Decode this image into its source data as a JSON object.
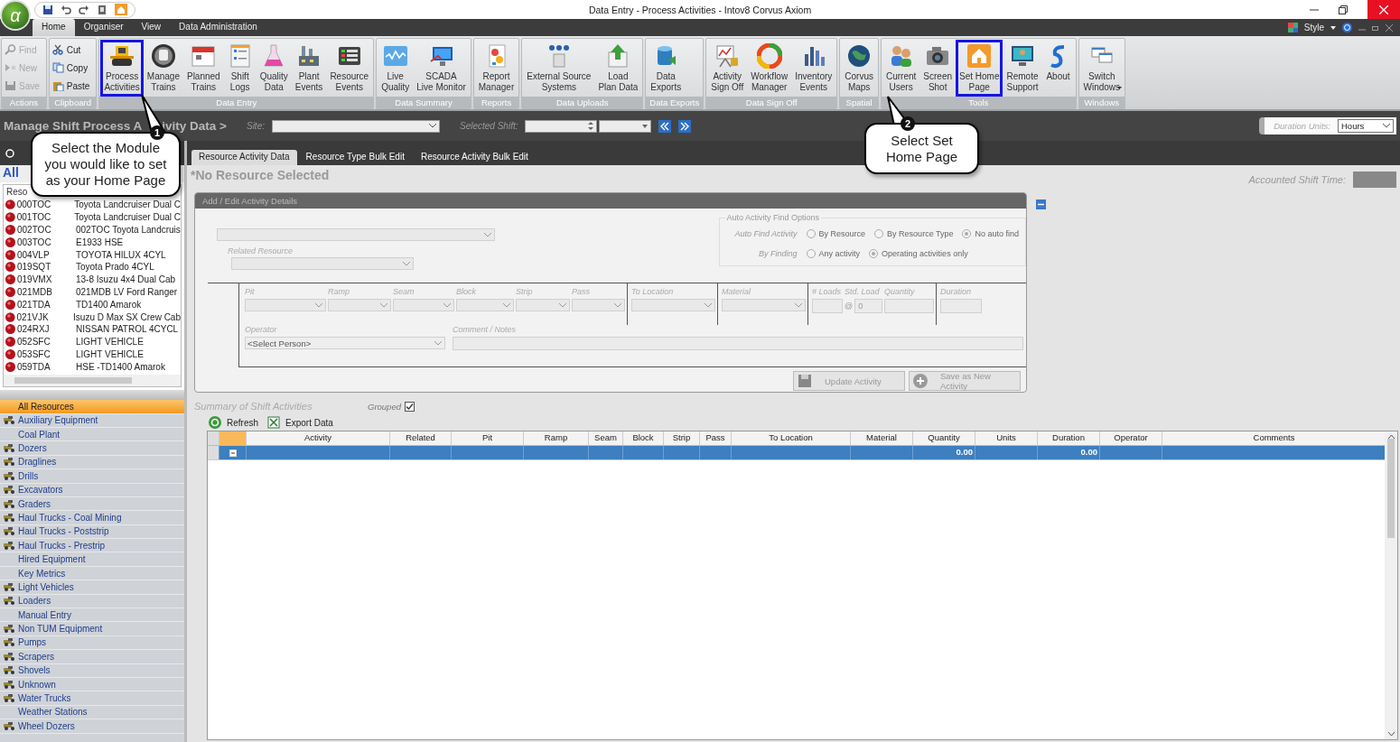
{
  "app_logo": "α",
  "window": {
    "title": "Data Entry - Process Activities - Intov8 Corvus Axiom"
  },
  "menu_tabs": [
    {
      "label": "Home",
      "selected": true
    },
    {
      "label": "Organiser",
      "selected": false
    },
    {
      "label": "View",
      "selected": false
    },
    {
      "label": "Data Administration",
      "selected": false
    }
  ],
  "style_menu": "Style",
  "ribbon": [
    {
      "label": "Actions",
      "kind": "small",
      "items": [
        {
          "label": "Find",
          "disabled": true
        },
        {
          "label": "New",
          "disabled": true
        },
        {
          "label": "Save",
          "disabled": true
        }
      ]
    },
    {
      "label": "Clipboard",
      "kind": "small",
      "items": [
        {
          "label": "Cut",
          "disabled": false
        },
        {
          "label": "Copy",
          "disabled": false
        },
        {
          "label": "Paste",
          "disabled": false
        }
      ]
    },
    {
      "label": "Data Entry",
      "kind": "large",
      "items": [
        {
          "lines": [
            "Process",
            "Activities"
          ],
          "highlighted": true
        },
        {
          "lines": [
            "Manage",
            "Trains"
          ],
          "highlighted": false
        },
        {
          "lines": [
            "Planned",
            "Trains"
          ],
          "highlighted": false
        },
        {
          "lines": [
            "Shift",
            "Logs"
          ],
          "highlighted": false
        },
        {
          "lines": [
            "Quality",
            "Data"
          ],
          "highlighted": false
        },
        {
          "lines": [
            "Plant",
            "Events"
          ],
          "highlighted": false
        },
        {
          "lines": [
            "Resource",
            "Events"
          ],
          "highlighted": false
        }
      ]
    },
    {
      "label": "Data Summary",
      "kind": "large",
      "items": [
        {
          "lines": [
            "Live",
            "Quality"
          ],
          "highlighted": false
        },
        {
          "lines": [
            "SCADA",
            "Live Monitor"
          ],
          "highlighted": false
        }
      ]
    },
    {
      "label": "Reports",
      "kind": "large",
      "items": [
        {
          "lines": [
            "Report",
            "Manager"
          ],
          "highlighted": false
        }
      ]
    },
    {
      "label": "Data Uploads",
      "kind": "large",
      "items": [
        {
          "lines": [
            "External Source",
            "Systems"
          ],
          "highlighted": false
        },
        {
          "lines": [
            "Load",
            "Plan Data"
          ],
          "highlighted": false
        }
      ]
    },
    {
      "label": "Data Exports",
      "kind": "large",
      "items": [
        {
          "lines": [
            "Data",
            "Exports"
          ],
          "highlighted": false
        }
      ]
    },
    {
      "label": "Data Sign Off",
      "kind": "large",
      "items": [
        {
          "lines": [
            "Activity",
            "Sign Off"
          ],
          "highlighted": false
        },
        {
          "lines": [
            "Workflow",
            "Manager"
          ],
          "highlighted": false
        },
        {
          "lines": [
            "Inventory",
            "Events"
          ],
          "highlighted": false
        }
      ]
    },
    {
      "label": "Spatial",
      "kind": "large",
      "items": [
        {
          "lines": [
            "Corvus",
            "Maps"
          ],
          "highlighted": false
        }
      ]
    },
    {
      "label": "Tools",
      "kind": "large",
      "items": [
        {
          "lines": [
            "Current",
            "Users"
          ],
          "highlighted": false
        },
        {
          "lines": [
            "Screen",
            "Shot"
          ],
          "highlighted": false
        },
        {
          "lines": [
            "Set Home",
            "Page"
          ],
          "highlighted": true
        },
        {
          "lines": [
            "Remote",
            "Support"
          ],
          "highlighted": false
        },
        {
          "lines": [
            "About"
          ],
          "highlighted": false
        }
      ]
    },
    {
      "label": "Windows",
      "kind": "large",
      "items": [
        {
          "lines": [
            "Switch",
            "Windows"
          ],
          "highlighted": false,
          "dropdown": true
        }
      ]
    }
  ],
  "header": {
    "title": "Manage Shift Process A",
    "title_rest": "ivity Data >",
    "site_label": "Site:",
    "shift_label": "Selected Shift:",
    "duration_units_label": "Duration Units:",
    "duration_units": "Hours"
  },
  "left_panel": {
    "radio_selected": false,
    "heading": "All",
    "column": "Reso",
    "resources": [
      {
        "code": "000TOC",
        "name": "Toyota Landcruiser Dual C"
      },
      {
        "code": "001TOC",
        "name": "Toyota Landcruiser Dual C"
      },
      {
        "code": "002TOC",
        "name": "002TOC Toyota Landcruis"
      },
      {
        "code": "003TOC",
        "name": "E1933 HSE"
      },
      {
        "code": "004VLP",
        "name": "TOYOTA HILUX 4CYL"
      },
      {
        "code": "019SQT",
        "name": "Toyota Prado 4CYL"
      },
      {
        "code": "019VMX",
        "name": "13-8 Isuzu 4x4 Dual Cab"
      },
      {
        "code": "021MDB",
        "name": "021MDB LV Ford Ranger"
      },
      {
        "code": "021TDA",
        "name": "TD1400 Amarok"
      },
      {
        "code": "021VJK",
        "name": "Isuzu D Max SX Crew Cab"
      },
      {
        "code": "024RXJ",
        "name": "NISSAN PATROL 4CYCL"
      },
      {
        "code": "052SFC",
        "name": "LIGHT VEHICLE"
      },
      {
        "code": "053SFC",
        "name": "LIGHT VEHICLE"
      },
      {
        "code": "059TDA",
        "name": "HSE -TD1400 Amarok"
      }
    ],
    "categories": [
      {
        "label": "All Resources",
        "selected": true,
        "icon": false
      },
      {
        "label": "Auxiliary Equipment",
        "selected": false,
        "icon": true
      },
      {
        "label": "Coal Plant",
        "selected": false,
        "icon": false
      },
      {
        "label": "Dozers",
        "selected": false,
        "icon": true
      },
      {
        "label": "Draglines",
        "selected": false,
        "icon": true
      },
      {
        "label": "Drills",
        "selected": false,
        "icon": true
      },
      {
        "label": "Excavators",
        "selected": false,
        "icon": true
      },
      {
        "label": "Graders",
        "selected": false,
        "icon": true
      },
      {
        "label": "Haul Trucks - Coal Mining",
        "selected": false,
        "icon": true
      },
      {
        "label": "Haul Trucks - Poststrip",
        "selected": false,
        "icon": true
      },
      {
        "label": "Haul Trucks - Prestrip",
        "selected": false,
        "icon": true
      },
      {
        "label": "Hired Equipment",
        "selected": false,
        "icon": false
      },
      {
        "label": "Key Metrics",
        "selected": false,
        "icon": false
      },
      {
        "label": "Light Vehicles",
        "selected": false,
        "icon": true
      },
      {
        "label": "Loaders",
        "selected": false,
        "icon": true
      },
      {
        "label": "Manual Entry",
        "selected": false,
        "icon": false
      },
      {
        "label": "Non TUM Equipment",
        "selected": false,
        "icon": true
      },
      {
        "label": "Pumps",
        "selected": false,
        "icon": true
      },
      {
        "label": "Scrapers",
        "selected": false,
        "icon": true
      },
      {
        "label": "Shovels",
        "selected": false,
        "icon": true
      },
      {
        "label": "Unknown",
        "selected": false,
        "icon": true
      },
      {
        "label": "Water Trucks",
        "selected": false,
        "icon": true
      },
      {
        "label": "Weather Stations",
        "selected": false,
        "icon": false
      },
      {
        "label": "Wheel Dozers",
        "selected": false,
        "icon": true
      }
    ]
  },
  "tabs": [
    {
      "label": "Resource Activity Data",
      "selected": true
    },
    {
      "label": "Resource Type Bulk Edit",
      "selected": false
    },
    {
      "label": "Resource Activity Bulk Edit",
      "selected": false
    }
  ],
  "resource_title": "*No Resource Selected",
  "accounted_label": "Accounted Shift Time:",
  "form": {
    "title": "Add / Edit Activity Details",
    "related_label": "Related Resource",
    "auto_find": {
      "legend": "Auto Activity Find Options",
      "rows": [
        {
          "label": "Auto Find Activity",
          "options": [
            {
              "label": "By Resource",
              "selected": false
            },
            {
              "label": "By Resource Type",
              "selected": false
            },
            {
              "label": "No auto find",
              "selected": true
            }
          ]
        },
        {
          "label": "By Finding",
          "options": [
            {
              "label": "Any activity",
              "selected": false
            },
            {
              "label": "Operating activities only",
              "selected": true
            }
          ]
        }
      ]
    },
    "fields": [
      {
        "label": "Pit",
        "kind": "select"
      },
      {
        "label": "Ramp",
        "kind": "select"
      },
      {
        "label": "Seam",
        "kind": "select"
      },
      {
        "label": "Block",
        "kind": "select"
      },
      {
        "label": "Strip",
        "kind": "select"
      },
      {
        "label": "Pass",
        "kind": "select"
      },
      {
        "label": "To Location",
        "kind": "select"
      },
      {
        "label": "Material",
        "kind": "select"
      },
      {
        "label": "# Loads",
        "kind": "text"
      },
      {
        "label": "Std. Load",
        "kind": "text",
        "value": "0",
        "prefix": "@"
      },
      {
        "label": "Quantity",
        "kind": "text"
      },
      {
        "label": "Duration",
        "kind": "text"
      }
    ],
    "operator_label": "Operator",
    "operator": "<Select Person>",
    "comment_label": "Comment / Notes",
    "buttons": [
      "Update Activity",
      "Save as New Activity"
    ]
  },
  "summary": {
    "title": "Summary of Shift Activities",
    "grouped_label": "Grouped",
    "grouped": true,
    "toolbar": [
      "Refresh",
      "Export Data"
    ]
  },
  "table": {
    "columns": [
      {
        "label": "Activity"
      },
      {
        "label": "Related"
      },
      {
        "label": "Pit"
      },
      {
        "label": "Ramp"
      },
      {
        "label": "Seam"
      },
      {
        "label": "Block"
      },
      {
        "label": "Strip"
      },
      {
        "label": "Pass"
      },
      {
        "label": "To Location"
      },
      {
        "label": "Material"
      },
      {
        "label": "Quantity",
        "total": "0.00"
      },
      {
        "label": "Units"
      },
      {
        "label": "Duration",
        "total": "0.00"
      },
      {
        "label": "Operator"
      },
      {
        "label": "Comments"
      }
    ],
    "group_row": {
      "selected": true,
      "expanded": true
    }
  },
  "callouts": [
    {
      "number": "1",
      "lines": [
        "Select the Module",
        "you would like to set",
        "as your Home Page"
      ]
    },
    {
      "number": "2",
      "lines": [
        "Select Set",
        "Home Page"
      ]
    }
  ]
}
